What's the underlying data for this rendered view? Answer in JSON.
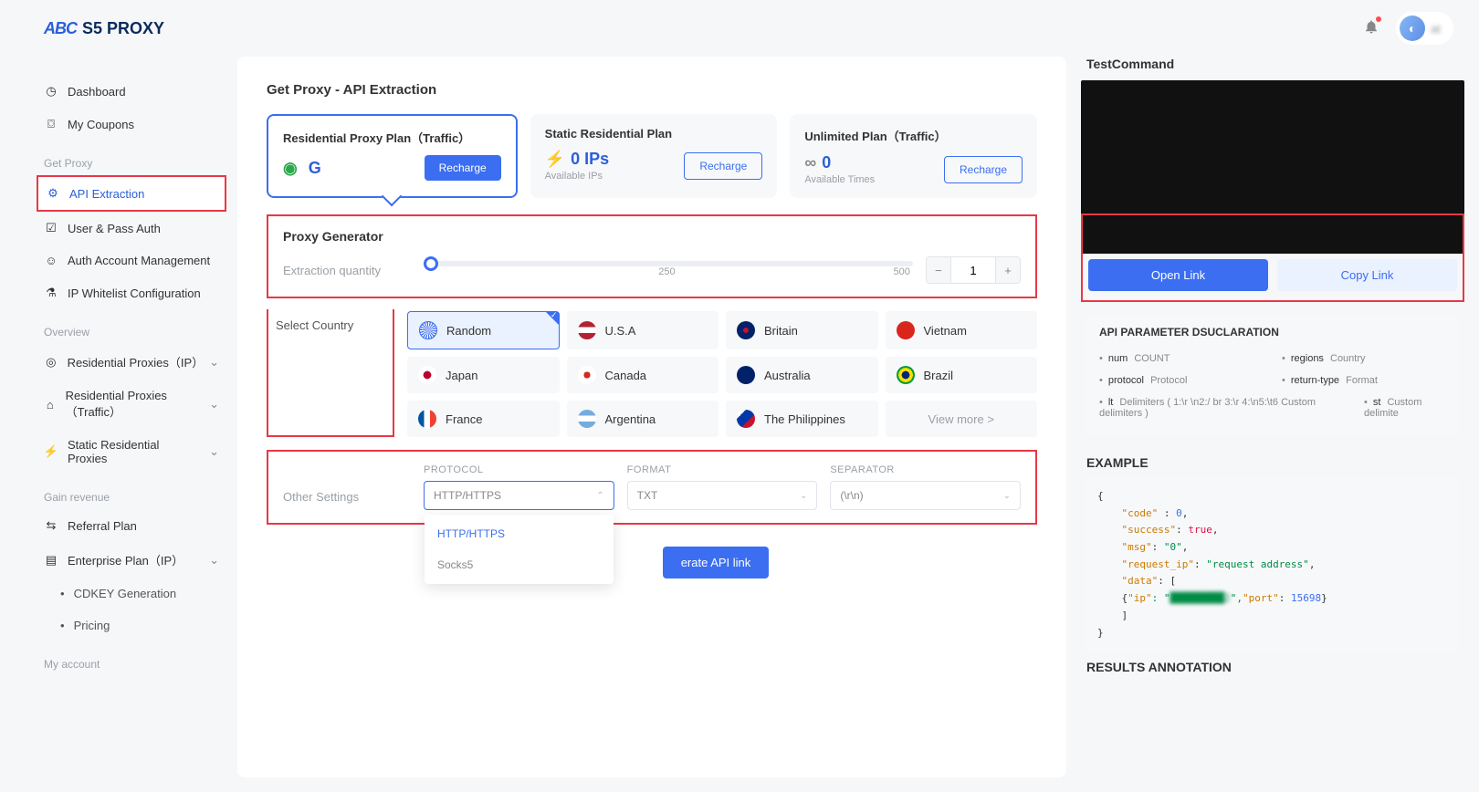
{
  "logo": {
    "mark": "ABC",
    "text": "S5 PROXY"
  },
  "header": {
    "avatar_label": "at"
  },
  "sidebar": {
    "dashboard": "Dashboard",
    "coupons": "My Coupons",
    "sec_getproxy": "Get Proxy",
    "api_extraction": "API Extraction",
    "user_pass": "User & Pass Auth",
    "auth_account": "Auth Account Management",
    "ip_whitelist": "IP Whitelist Configuration",
    "sec_overview": "Overview",
    "res_ip": "Residential Proxies（IP）",
    "res_traffic": "Residential Proxies（Traffic）",
    "static_res": "Static Residential Proxies",
    "sec_gain": "Gain revenue",
    "referral": "Referral Plan",
    "enterprise": "Enterprise Plan（IP）",
    "cdkey": "CDKEY Generation",
    "pricing": "Pricing",
    "sec_account": "My account"
  },
  "page": {
    "title": "Get Proxy - API Extraction"
  },
  "plans": {
    "a": {
      "title": "Residential Proxy Plan（Traffic）",
      "value_masked": "    ",
      "unit": "G",
      "btn": "Recharge"
    },
    "b": {
      "title": "Static Residential Plan",
      "value": "0 IPs",
      "sub": "Available IPs",
      "btn": "Recharge"
    },
    "c": {
      "title": "Unlimited Plan（Traffic）",
      "value": "0",
      "sub": "Available Times",
      "btn": "Recharge"
    }
  },
  "generator": {
    "title": "Proxy Generator",
    "qty_label": "Extraction quantity",
    "tick1": "250",
    "tick2": "500",
    "value": "1"
  },
  "country": {
    "label": "Select Country",
    "items": {
      "random": "Random",
      "usa": "U.S.A",
      "britain": "Britain",
      "vietnam": "Vietnam",
      "japan": "Japan",
      "canada": "Canada",
      "australia": "Australia",
      "brazil": "Brazil",
      "france": "France",
      "argentina": "Argentina",
      "philippines": "The Philippines",
      "more": "View more >"
    }
  },
  "settings": {
    "label": "Other Settings",
    "protocol": {
      "label": "PROTOCOL",
      "value": "HTTP/HTTPS",
      "opt1": "HTTP/HTTPS",
      "opt2": "Socks5"
    },
    "format": {
      "label": "FORMAT",
      "value": "TXT"
    },
    "separator": {
      "label": "SEPARATOR",
      "value": "(\\r\\n)"
    }
  },
  "gen_btn": "erate API link",
  "right": {
    "test_cmd": "TestCommand",
    "open_link": "Open Link",
    "copy_link": "Copy Link",
    "param_title": "API PARAMETER DSUCLARATION",
    "params": {
      "num": {
        "k": "num",
        "v": "COUNT"
      },
      "regions": {
        "k": "regions",
        "v": "Country"
      },
      "protocol": {
        "k": "protocol",
        "v": "Protocol"
      },
      "return": {
        "k": "return-type",
        "v": "Format"
      },
      "lt": {
        "k": "lt",
        "v": "Delimiters ( 1:\\r \\n2:/ br 3:\\r 4:\\n5:\\t6 Custom delimiters )"
      },
      "st": {
        "k": "st",
        "v": "Custom delimite"
      }
    },
    "example": "EXAMPLE",
    "results": "RESULTS ANNOTATION",
    "code": {
      "l1": "{",
      "l2a": "    \"code\"",
      "l2b": " : ",
      "l2c": "0",
      "l2d": ",",
      "l3a": "    \"success\"",
      "l3b": ": ",
      "l3c": "true",
      "l3d": ",",
      "l4a": "    \"msg\"",
      "l4b": ": ",
      "l4c": "\"0\"",
      "l4d": ",",
      "l5a": "    \"request_ip\"",
      "l5b": ": ",
      "l5c": "\"request address\"",
      "l5d": ",",
      "l6a": "    \"data\"",
      "l6b": ": [",
      "l7a": "    {",
      "l7b": "\"ip\"",
      "l7c": ": \"",
      "l7d": "█████████2",
      "l7e": "\",",
      "l7f": "\"port\"",
      "l7g": ": ",
      "l7h": "15698",
      "l7i": "}",
      "l8": "    ]",
      "l9": "}"
    }
  }
}
